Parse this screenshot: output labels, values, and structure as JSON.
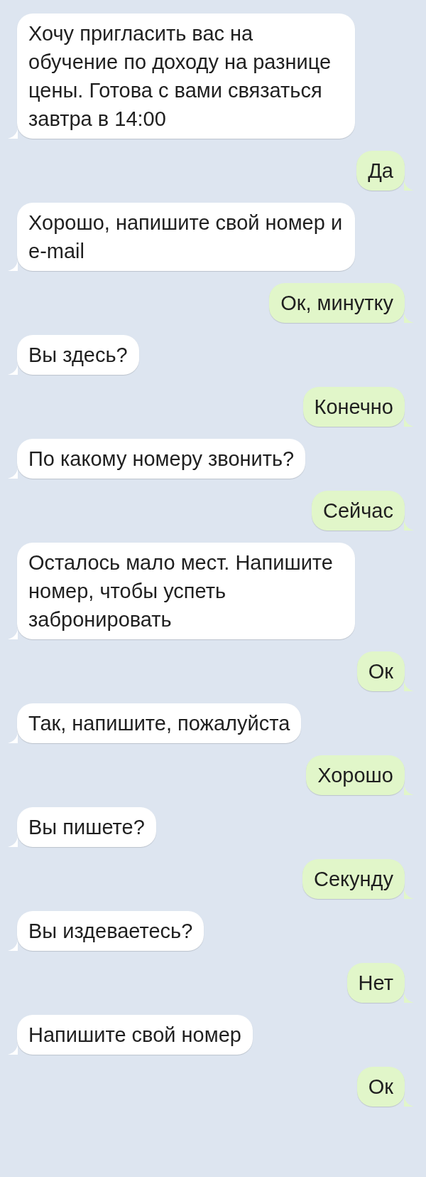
{
  "messages": [
    {
      "kind": "incoming",
      "text": "Хочу пригласить вас на обучение по доходу на разнице цены. Готова с вами связаться завтра в 14:00"
    },
    {
      "kind": "outgoing",
      "text": "Да"
    },
    {
      "kind": "incoming",
      "text": "Хорошо, напишите свой номер и e-mail"
    },
    {
      "kind": "outgoing",
      "text": "Ок, минутку"
    },
    {
      "kind": "incoming",
      "text": "Вы здесь?"
    },
    {
      "kind": "outgoing",
      "text": "Конечно"
    },
    {
      "kind": "incoming",
      "text": "По какому номеру звонить?"
    },
    {
      "kind": "outgoing",
      "text": "Сейчас"
    },
    {
      "kind": "incoming",
      "text": "Осталось мало мест. Напишите номер, чтобы успеть забронировать"
    },
    {
      "kind": "outgoing",
      "text": "Ок"
    },
    {
      "kind": "incoming",
      "text": "Так, напишите, пожалуйста"
    },
    {
      "kind": "outgoing",
      "text": "Хорошо"
    },
    {
      "kind": "incoming",
      "text": "Вы пишете?"
    },
    {
      "kind": "outgoing",
      "text": "Секунду"
    },
    {
      "kind": "incoming",
      "text": "Вы издеваетесь?"
    },
    {
      "kind": "outgoing",
      "text": "Нет"
    },
    {
      "kind": "incoming",
      "text": "Напишите свой номер"
    },
    {
      "kind": "outgoing",
      "text": "Ок"
    }
  ]
}
